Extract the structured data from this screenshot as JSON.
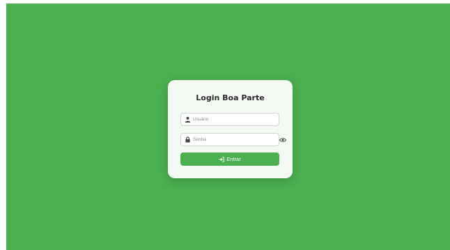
{
  "login": {
    "title": "Login Boa Parte",
    "username": {
      "placeholder": "Usuário",
      "value": "",
      "icon": "user-icon"
    },
    "password": {
      "placeholder": "Senha",
      "value": "",
      "icon": "lock-icon",
      "toggle_icon": "eye-icon"
    },
    "submit": {
      "label": "Entrar",
      "icon": "sign-in-icon"
    }
  },
  "colors": {
    "background": "#4caf50",
    "card": "#f5f9f4",
    "button": "#4caf50",
    "title": "#2b2b2b"
  }
}
